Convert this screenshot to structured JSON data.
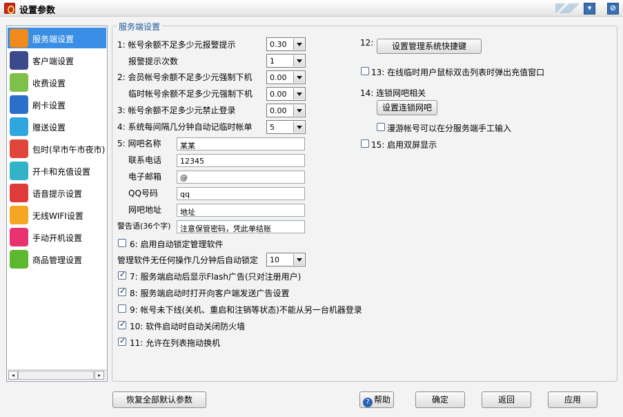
{
  "window": {
    "title": "设置参数",
    "min_glyph": "▾",
    "close_glyph": "⊘"
  },
  "sidebar": {
    "items": [
      {
        "label": "服务端设置",
        "icon": "server-monitor-icon",
        "color": "#f08a1c",
        "active": true
      },
      {
        "label": "客户端设置",
        "icon": "client-monitor-icon",
        "color": "#3b4a8a"
      },
      {
        "label": "收费设置",
        "icon": "billing-icon",
        "color": "#7dc04a"
      },
      {
        "label": "刷卡设置",
        "icon": "card-icon",
        "color": "#2a6fc9"
      },
      {
        "label": "赠送设置",
        "icon": "gift-icon",
        "color": "#2ea6df"
      },
      {
        "label": "包时(早市午市夜市)",
        "icon": "clock-icon",
        "color": "#e0453a"
      },
      {
        "label": "开卡和充值设置",
        "icon": "open-card-icon",
        "color": "#33b3c8"
      },
      {
        "label": "语音提示设置",
        "icon": "microphone-icon",
        "color": "#e03b3b"
      },
      {
        "label": "无线WIFI设置",
        "icon": "wifi-icon",
        "color": "#f5a623"
      },
      {
        "label": "手动开机设置",
        "icon": "hand-pointer-icon",
        "color": "#e8336e"
      },
      {
        "label": "商品管理设置",
        "icon": "shopping-cart-icon",
        "color": "#5cb82e"
      }
    ],
    "scroll_left": "◂",
    "scroll_right": "▸"
  },
  "server": {
    "group_title": "服务端设置",
    "balance_alert_label": "1: 帐号余额不足多少元报警提示",
    "balance_alert_value": "0.30",
    "alert_times_label": "报警提示次数",
    "alert_times_value": "1",
    "member_force_off_label": "2: 会员帐号余额不足多少元强制下机",
    "member_force_off_value": "0.00",
    "temp_force_off_label": "临时帐号余额不足多少元强制下机",
    "temp_force_off_value": "0.00",
    "forbid_login_label": "3: 帐号余额不足多少元禁止登录",
    "forbid_login_value": "0.00",
    "auto_bill_label": "4: 系统每间隔几分钟自动记临时帐单",
    "auto_bill_value": "5",
    "cafe_name_label": "5: 网吧名称",
    "cafe_name_value": "某某",
    "phone_label": "联系电话",
    "phone_value": "12345",
    "email_label": "电子邮箱",
    "email_value": "@",
    "qq_label": "QQ号码",
    "qq_value": "qq",
    "address_label": "网吧地址",
    "address_value": "地址",
    "warning_label": "警告语(36个字)",
    "warning_value": "注意保管密码，凭此单结账",
    "opt6_label": "6: 启用自动锁定管理软件",
    "opt6_checked": false,
    "lock_minutes_label": "管理软件无任何操作几分钟后自动锁定",
    "lock_minutes_value": "10",
    "opt7_label": "7: 服务端启动后显示Flash广告(只对注册用户)",
    "opt7_checked": true,
    "opt8_label": "8: 服务端启动时打开向客户端发送广告设置",
    "opt8_checked": true,
    "opt9_label": "9: 帐号未下线(关机、重启和注销等状态)不能从另一台机器登录",
    "opt9_checked": false,
    "opt10_label": "10: 软件启动时自动关闭防火墙",
    "opt10_checked": true,
    "opt11_label": "11: 允许在列表拖动换机",
    "opt11_checked": true,
    "opt12_label": "12:",
    "shortcut_button": "设置管理系统快捷键",
    "opt13_label": "13: 在线临时用户鼠标双击列表时弹出充值窗口",
    "opt13_checked": false,
    "opt14_label": "14: 连锁网吧相关",
    "chain_button": "设置连锁网吧",
    "roaming_label": "漫游帐号可以在分服务端手工输入",
    "roaming_checked": false,
    "opt15_label": "15: 启用双屏显示",
    "opt15_checked": false
  },
  "footer": {
    "restore_button": "恢复全部默认参数",
    "help_icon": "?",
    "help_button": "帮助",
    "ok_button": "确定",
    "back_button": "返回",
    "apply_button": "应用"
  }
}
